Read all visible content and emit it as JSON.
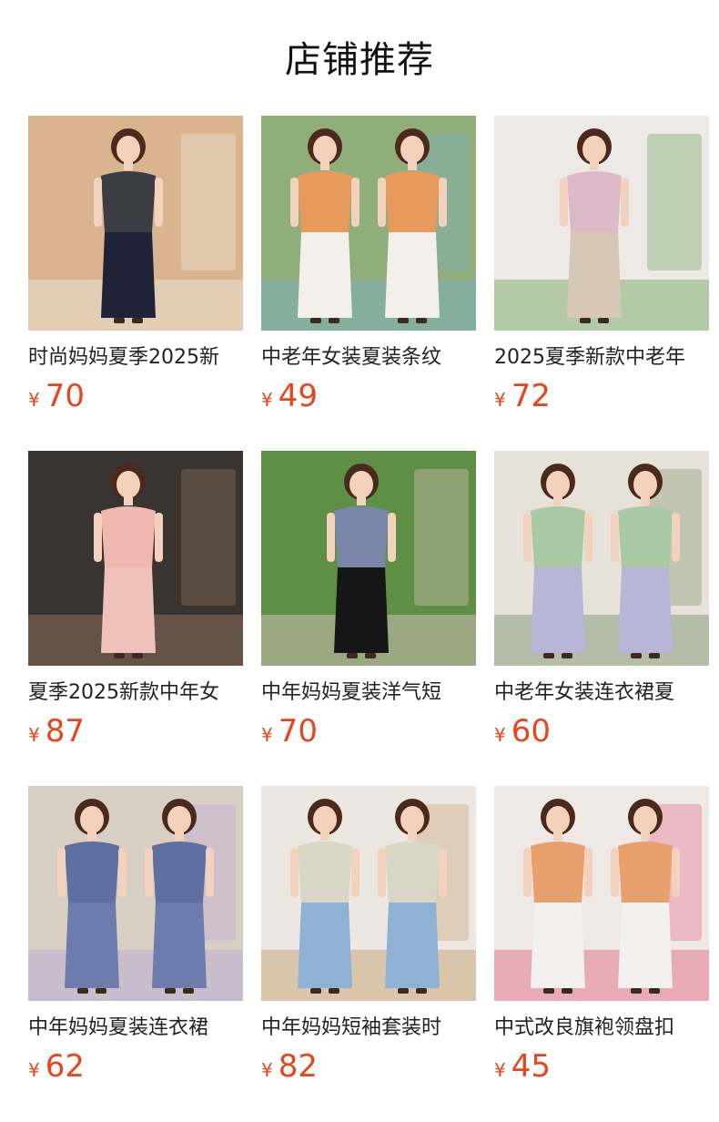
{
  "section_title": "店铺推荐",
  "currency_symbol": "¥",
  "products": [
    {
      "title": "时尚妈妈夏季2025新",
      "price": "70",
      "palette": {
        "bg": "#d9b48e",
        "top": "#3c3c44",
        "bottom": "#1f2338",
        "accent": "#f1ece4"
      }
    },
    {
      "title": "中老年女装夏装条纹",
      "price": "49",
      "palette": {
        "bg": "#8fae7a",
        "top": "#e89a5c",
        "bottom": "#f3f0ea",
        "accent": "#7bb0c9"
      }
    },
    {
      "title": "2025夏季新款中老年",
      "price": "72",
      "palette": {
        "bg": "#ece9e6",
        "top": "#dbb9c6",
        "bottom": "#d6c7b6",
        "accent": "#6fa45a"
      }
    },
    {
      "title": "夏季2025新款中年女",
      "price": "87",
      "palette": {
        "bg": "#3a3431",
        "top": "#f0b8b0",
        "bottom": "#eec2ba",
        "accent": "#9a7b62"
      }
    },
    {
      "title": "中年妈妈夏装洋气短",
      "price": "70",
      "palette": {
        "bg": "#5e8f45",
        "top": "#7a86a8",
        "bottom": "#161616",
        "accent": "#e8c7c9"
      }
    },
    {
      "title": "中老年女装连衣裙夏",
      "price": "60",
      "palette": {
        "bg": "#e6e2da",
        "top": "#a9c9a4",
        "bottom": "#b8b5d6",
        "accent": "#7a8f68"
      }
    },
    {
      "title": "中年妈妈夏装连衣裙",
      "price": "62",
      "palette": {
        "bg": "#d8cfc3",
        "top": "#5e6fa0",
        "bottom": "#6b7cad",
        "accent": "#b9a3d6"
      }
    },
    {
      "title": "中年妈妈短袖套装时",
      "price": "82",
      "palette": {
        "bg": "#ece7e1",
        "top": "#d9d6c6",
        "bottom": "#8fb2d4",
        "accent": "#c49a6c"
      }
    },
    {
      "title": "中式改良旗袍领盘扣",
      "price": "45",
      "palette": {
        "bg": "#efe9e6",
        "top": "#e8a06e",
        "bottom": "#f3f1ee",
        "accent": "#e2607a"
      }
    }
  ]
}
